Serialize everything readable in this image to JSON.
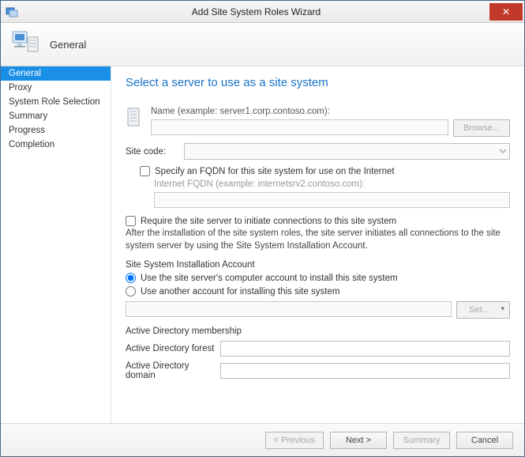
{
  "window": {
    "title": "Add Site System Roles Wizard",
    "close_glyph": "✕"
  },
  "header": {
    "label": "General"
  },
  "sidebar": {
    "items": [
      {
        "label": "General",
        "active": true
      },
      {
        "label": "Proxy",
        "active": false
      },
      {
        "label": "System Role Selection",
        "active": false
      },
      {
        "label": "Summary",
        "active": false
      },
      {
        "label": "Progress",
        "active": false
      },
      {
        "label": "Completion",
        "active": false
      }
    ]
  },
  "main": {
    "heading": "Select a server to use as a site system",
    "name_label": "Name (example: server1.corp.contoso.com):",
    "name_value": "",
    "browse_label": "Browse...",
    "site_code_label": "Site code:",
    "site_code_value": "",
    "fqdn_check_label": "Specify an FQDN for this site system for use on the Internet",
    "fqdn_sublabel": "Internet FQDN (example: internetsrv2.contoso.com):",
    "fqdn_value": "",
    "require_check_label": "Require the site server to initiate connections to this site system",
    "require_note": "After the installation of the site system roles, the site server initiates all connections to the site system server by using the Site System Installation Account.",
    "install_account_heading": "Site System Installation Account",
    "radio_computer_label": "Use the site server's computer account to install this site system",
    "radio_other_label": "Use another account for installing this site system",
    "account_value": "",
    "set_label": "Set...",
    "ad_heading": "Active Directory membership",
    "ad_forest_label": "Active Directory forest",
    "ad_forest_value": "",
    "ad_domain_label": "Active Directory domain",
    "ad_domain_value": ""
  },
  "footer": {
    "previous": "< Previous",
    "next": "Next >",
    "summary": "Summary",
    "cancel": "Cancel"
  }
}
